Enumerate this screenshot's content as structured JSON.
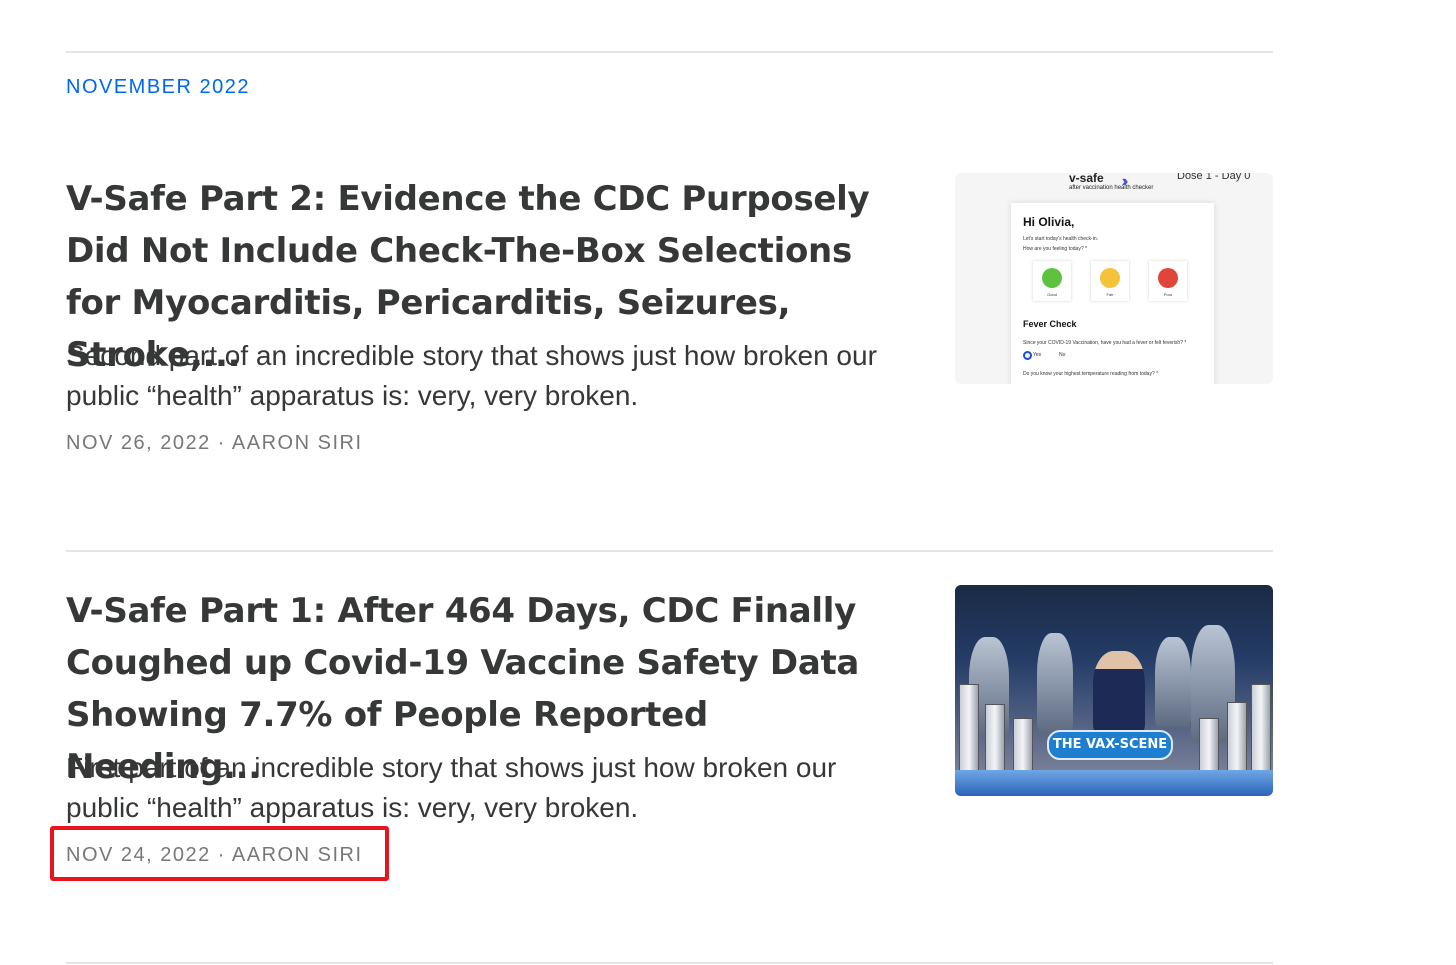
{
  "archive": {
    "month_header": "NOVEMBER 2022"
  },
  "posts": [
    {
      "title": "V-Safe Part 2: Evidence the CDC Purposely Did Not Include Check-The-Box Selections for Myocarditis, Pericarditis, Seizures, Stroke,...",
      "description": "Second part of an incredible story that shows just how broken our public “health” apparatus is: very, very broken.",
      "meta": "NOV 26, 2022 · AARON SIRI",
      "thumbnail": {
        "logo": "v-safe",
        "logo_sub": "after vaccination health checker",
        "dose": "Dose 1 - Day 0",
        "greeting": "Hi Olivia,",
        "intro": "Let's start today's health check-in.",
        "question": "How are you feeling today? *",
        "faces": [
          "Good",
          "Fair",
          "Poor"
        ],
        "section": "Fever Check",
        "fever_question": "Since your COVID-19 Vaccination, have you had a fever or felt feverish? *",
        "options": [
          "Yes",
          "No"
        ],
        "temp_question": "Do you know your highest temperature reading from today? *"
      }
    },
    {
      "title": "V-Safe Part 1: After 464 Days, CDC Finally Coughed up Covid-19 Vaccine Safety Data Showing 7.7% of People Reported Needing...",
      "description": "First part of an incredible story that shows just how broken our public “health” apparatus is: very, very broken.",
      "meta": "NOV 24, 2022 · AARON SIRI",
      "thumbnail": {
        "banner": "THE VAX-SCENE"
      }
    }
  ],
  "colors": {
    "accent": "#0068ef",
    "highlight": "#e8131b",
    "text": "#363737",
    "meta": "#777777"
  }
}
